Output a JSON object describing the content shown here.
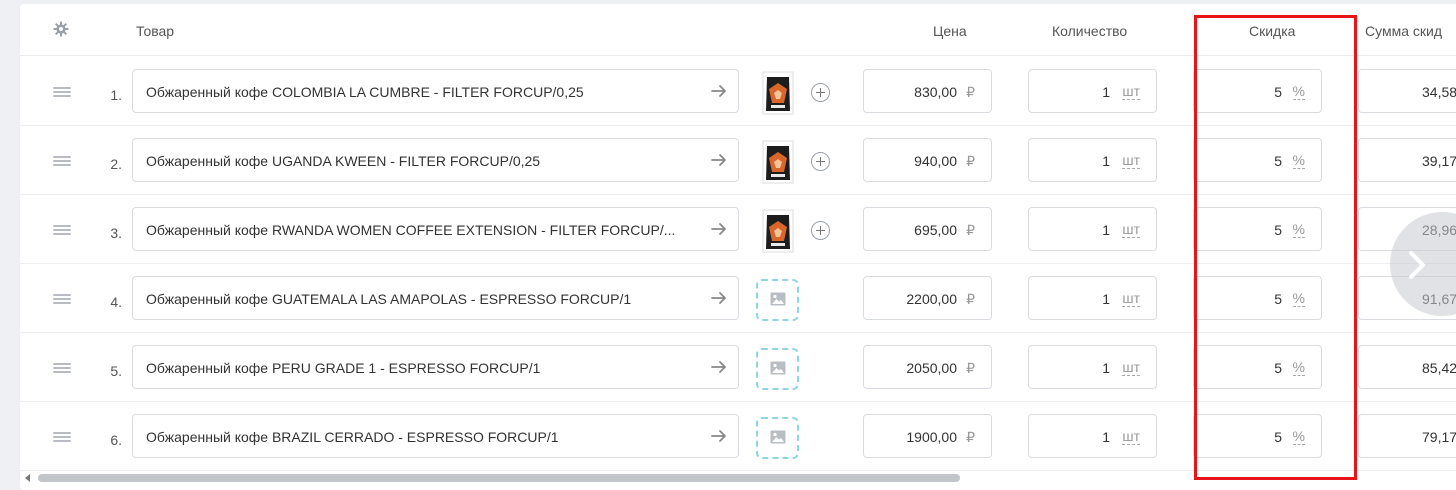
{
  "header": {
    "settings_icon": "gear-icon",
    "col_product": "Товар",
    "col_price": "Цена",
    "col_quantity": "Количество",
    "col_discount": "Скидка",
    "col_discount_sum": "Сумма скид"
  },
  "currency": "₽",
  "qty_unit": "шт",
  "discount_unit": "%",
  "rows": [
    {
      "num": "1.",
      "name": "Обжаренный кофе COLOMBIA  LA CUMBRE - FILTER FORCUP/0,25",
      "image": "coffee-bag-photo",
      "price": "830,00",
      "qty": "1",
      "discount": "5",
      "discount_sum": "34,58"
    },
    {
      "num": "2.",
      "name": "Обжаренный кофе UGANDA KWEEN - FILTER FORCUP/0,25",
      "image": "coffee-bag-photo",
      "price": "940,00",
      "qty": "1",
      "discount": "5",
      "discount_sum": "39,17"
    },
    {
      "num": "3.",
      "name": "Обжаренный кофе RWANDA WOMEN COFFEE EXTENSION - FILTER FORCUP/...",
      "image": "coffee-bag-photo",
      "price": "695,00",
      "qty": "1",
      "discount": "5",
      "discount_sum": "28,96"
    },
    {
      "num": "4.",
      "name": "Обжаренный кофе GUATEMALA LAS AMAPOLAS - ESPRESSO FORCUP/1",
      "image": "image-placeholder-icon",
      "price": "2200,00",
      "qty": "1",
      "discount": "5",
      "discount_sum": "91,67"
    },
    {
      "num": "5.",
      "name": "Обжаренный кофе PERU GRADE 1 - ESPRESSO FORCUP/1",
      "image": "image-placeholder-icon",
      "price": "2050,00",
      "qty": "1",
      "discount": "5",
      "discount_sum": "85,42"
    },
    {
      "num": "6.",
      "name": "Обжаренный кофе BRAZIL CERRADO - ESPRESSO FORCUP/1",
      "image": "image-placeholder-icon",
      "price": "1900,00",
      "qty": "1",
      "discount": "5",
      "discount_sum": "79,17"
    }
  ],
  "colors": {
    "highlight": "#e8141a",
    "placeholder_border": "#8fd6e1"
  }
}
